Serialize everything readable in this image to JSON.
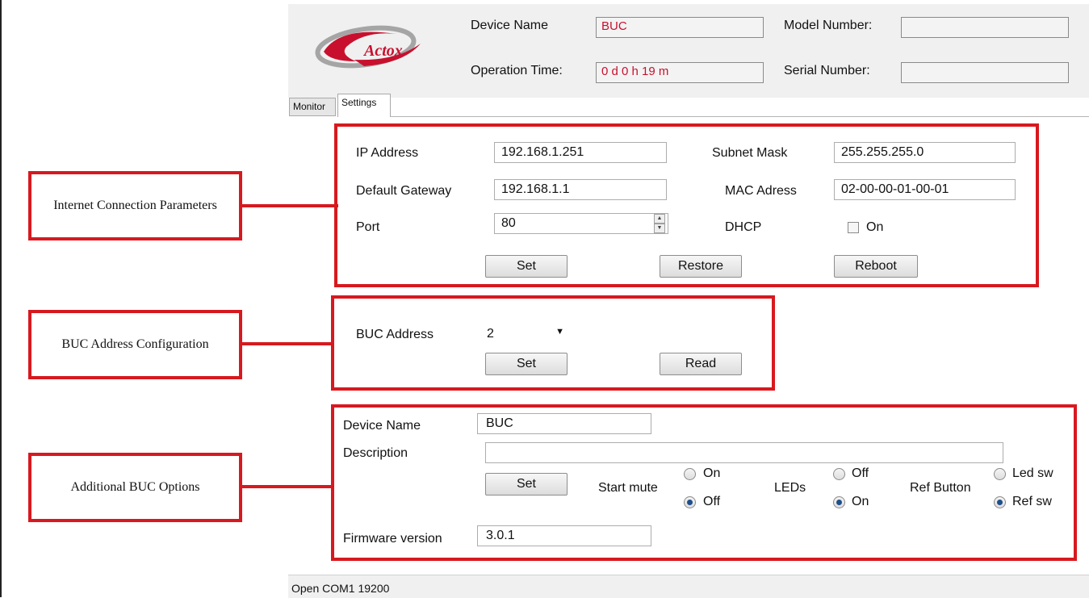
{
  "header": {
    "device_name_label": "Device Name",
    "device_name_value": "BUC",
    "operation_time_label": "Operation Time:",
    "operation_time_value": "0 d 0 h 19 m",
    "model_number_label": "Model Number:",
    "model_number_value": "",
    "serial_number_label": "Serial Number:",
    "serial_number_value": "",
    "logo_text": "Actox"
  },
  "tabs": [
    {
      "label": "Monitor",
      "active": false
    },
    {
      "label": "Settings",
      "active": true
    }
  ],
  "annotations": {
    "internet": "Internet Connection Parameters",
    "buc_address": "BUC Address Configuration",
    "additional": "Additional BUC Options"
  },
  "network": {
    "ip_label": "IP Address",
    "ip_value": "192.168.1.251",
    "subnet_label": "Subnet Mask",
    "subnet_value": "255.255.255.0",
    "gateway_label": "Default Gateway",
    "gateway_value": "192.168.1.1",
    "mac_label": "MAC Adress",
    "mac_value": "02-00-00-01-00-01",
    "port_label": "Port",
    "port_value": "80",
    "dhcp_label": "DHCP",
    "dhcp_option": "On",
    "set_button": "Set",
    "restore_button": "Restore",
    "reboot_button": "Reboot"
  },
  "address": {
    "label": "BUC Address",
    "value": "2",
    "set_button": "Set",
    "read_button": "Read"
  },
  "options": {
    "device_name_label": "Device Name",
    "device_name_value": "BUC",
    "description_label": "Description",
    "description_value": "",
    "set_button": "Set",
    "start_mute_label": "Start mute",
    "start_mute_on": "On",
    "start_mute_off": "Off",
    "leds_label": "LEDs",
    "leds_off": "Off",
    "leds_on": "On",
    "ref_button_label": "Ref Button",
    "ref_led_sw": "Led sw",
    "ref_ref_sw": "Ref sw",
    "firmware_label": "Firmware version",
    "firmware_value": "3.0.1"
  },
  "statusbar": {
    "text": "Open COM1  19200"
  },
  "colors": {
    "annotation_red": "#d7191f",
    "header_value_red": "#c8102e"
  }
}
